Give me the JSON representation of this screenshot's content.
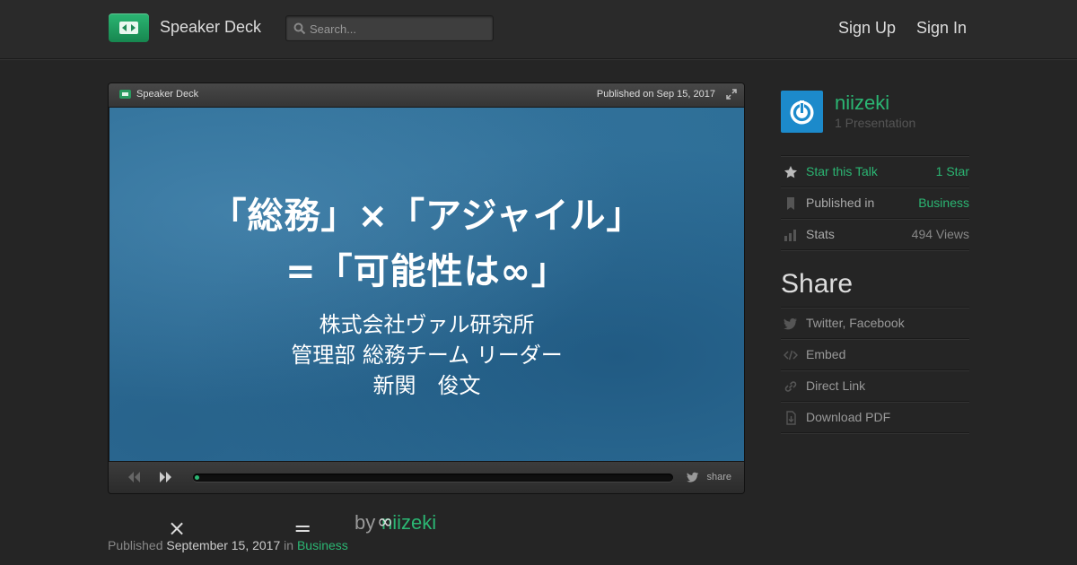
{
  "header": {
    "brand": "Speaker Deck",
    "search_placeholder": "Search...",
    "sign_up": "Sign Up",
    "sign_in": "Sign In"
  },
  "player": {
    "brand": "Speaker Deck",
    "published": "Published on Sep 15, 2017",
    "share_label": "share",
    "progress_fraction": 0.01
  },
  "slide": {
    "title_line1": "「総務」×「アジャイル」",
    "title_line2": "=「可能性は∞」",
    "sub_line1": "株式会社ヴァル研究所",
    "sub_line2": "管理部 総務チーム リーダー",
    "sub_line3": "新関　俊文"
  },
  "talk": {
    "title": "×　　　　　=",
    "title_tail": "∞",
    "by": "by",
    "author": "niizeki",
    "published_prefix": "Published",
    "published_date": "September 15, 2017",
    "in_word": "in",
    "category": "Business"
  },
  "sidebar": {
    "author_name": "niizeki",
    "presentation_count": "1 Presentation",
    "star_label": "Star this Talk",
    "star_count": "1 Star",
    "published_in_label": "Published in",
    "published_in_value": "Business",
    "stats_label": "Stats",
    "stats_value": "494 Views",
    "share_heading": "Share",
    "share_items": [
      "Twitter, Facebook",
      "Embed",
      "Direct Link",
      "Download PDF"
    ]
  },
  "colors": {
    "accent": "#2bb673",
    "avatar_bg": "#1c8acb",
    "slide_bg": "#2e6f98",
    "page_bg": "#252525"
  }
}
